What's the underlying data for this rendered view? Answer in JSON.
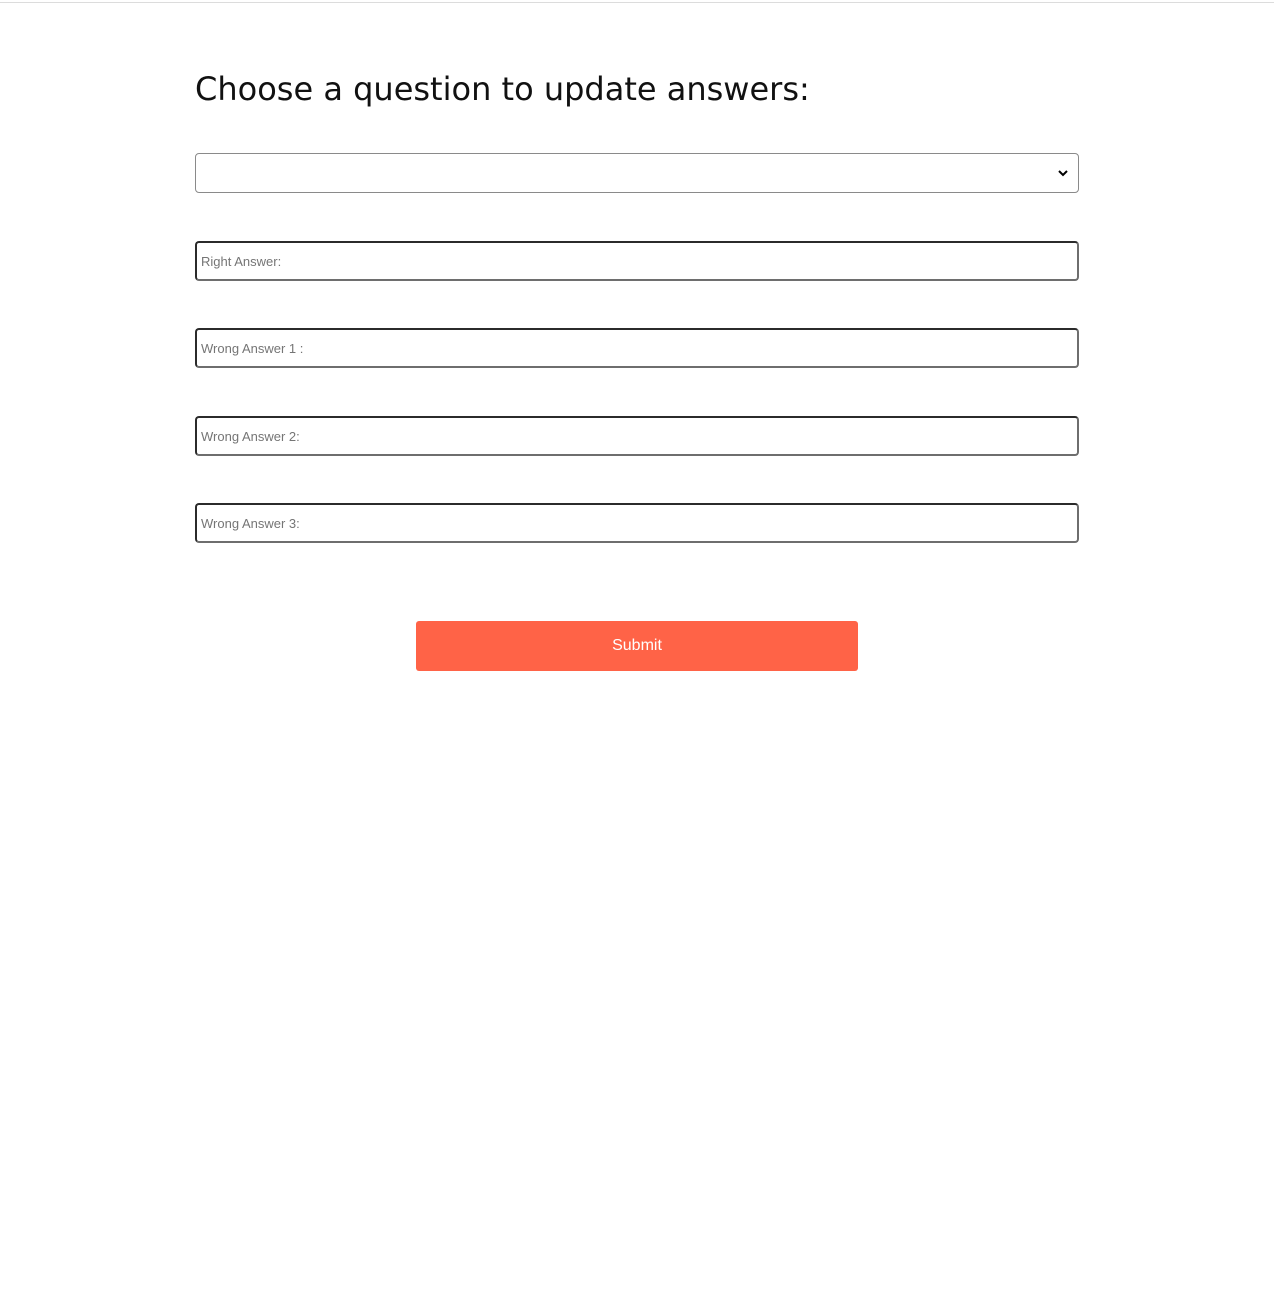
{
  "page": {
    "title": "Choose a question to update answers:"
  },
  "question_select": {
    "selected_value": ""
  },
  "inputs": {
    "right_answer": {
      "placeholder": "Right Answer:",
      "value": ""
    },
    "wrong_answer_1": {
      "placeholder": "Wrong Answer 1 :",
      "value": ""
    },
    "wrong_answer_2": {
      "placeholder": "Wrong Answer 2:",
      "value": ""
    },
    "wrong_answer_3": {
      "placeholder": "Wrong Answer 3:",
      "value": ""
    }
  },
  "submit": {
    "label": "Submit"
  },
  "colors": {
    "accent": "#ff6347",
    "button_text": "#ffffff"
  },
  "icons": {
    "select_arrow": "chevron-down-icon"
  }
}
